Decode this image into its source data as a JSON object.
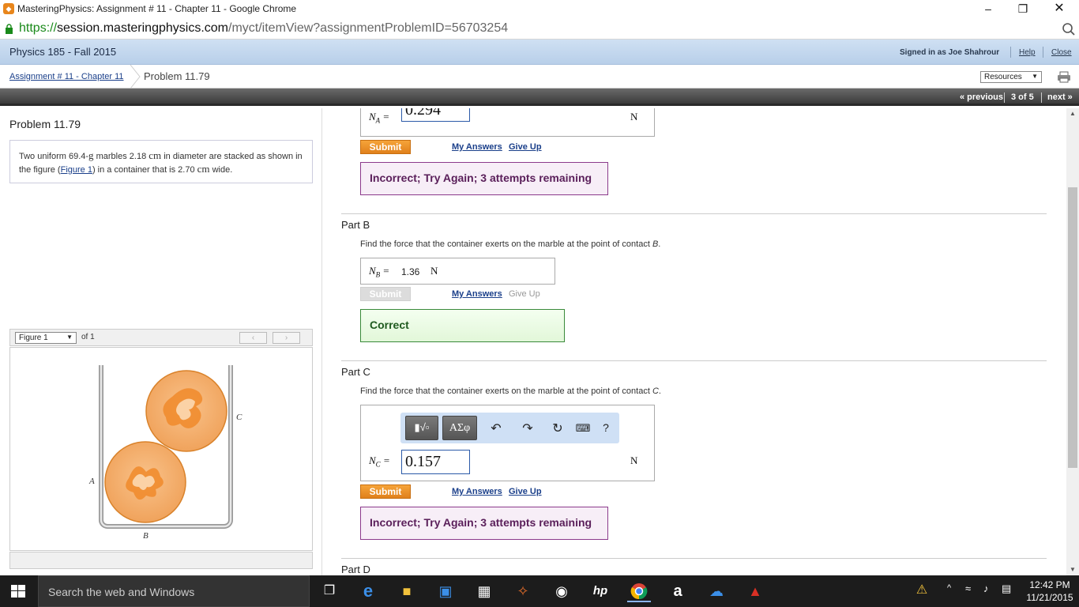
{
  "window": {
    "title": "MasteringPhysics: Assignment # 11 - Chapter 11 - Google Chrome"
  },
  "address": {
    "scheme": "https://",
    "host": "session.masteringphysics.com",
    "path": "/myct/itemView?assignmentProblemID=56703254"
  },
  "course": {
    "name": "Physics 185 - Fall 2015",
    "signed_in": "Signed in as Joe Shahrour",
    "help": "Help",
    "close": "Close"
  },
  "breadcrumb": {
    "assignment": "Assignment # 11 - Chapter 11",
    "problem": "Problem 11.79",
    "resources": "Resources"
  },
  "nav": {
    "previous": "« previous",
    "position": "3 of 5",
    "next": "next »"
  },
  "problem": {
    "title": "Problem 11.79",
    "desc_1": "Two uniform 69.4-",
    "desc_g": "g",
    "desc_2": " marbles 2.18 ",
    "desc_cm1": "cm",
    "desc_3": " in diameter are stacked as shown in the figure (",
    "desc_link": "Figure 1",
    "desc_4": ") in a container that is 2.70 ",
    "desc_cm2": "cm",
    "desc_5": " wide.",
    "figure_select": "Figure 1",
    "figure_of": "of 1",
    "figure_labels": {
      "a": "A",
      "b": "B",
      "c": "C"
    }
  },
  "partA": {
    "var": "N",
    "sub": "A",
    "eq": " =",
    "value": "0.294",
    "unit": "N",
    "submit": "Submit",
    "my_answers": "My Answers",
    "give_up": "Give Up",
    "feedback": "Incorrect; Try Again; 3 attempts remaining"
  },
  "partB": {
    "header": "Part B",
    "question_1": "Find the force that the container exerts on the marble at the point of contact ",
    "question_pt": "B",
    "question_2": ".",
    "var": "N",
    "sub": "B",
    "eq": " =",
    "value": "1.36",
    "unit": "N",
    "submit": "Submit",
    "my_answers": "My Answers",
    "give_up": "Give Up",
    "feedback": "Correct"
  },
  "partC": {
    "header": "Part C",
    "question_1": "Find the force that the container exerts on the marble at the point of contact ",
    "question_pt": "C",
    "question_2": ".",
    "toolbar_greek": "ΑΣφ",
    "toolbar_help": "?",
    "var": "N",
    "sub": "C",
    "eq": " =",
    "value": "0.157",
    "unit": "N",
    "submit": "Submit",
    "my_answers": "My Answers",
    "give_up": "Give Up",
    "feedback": "Incorrect; Try Again; 3 attempts remaining"
  },
  "partD": {
    "header": "Part D"
  },
  "taskbar": {
    "search": "Search the web and Windows",
    "time": "12:42 PM",
    "date": "11/21/2015"
  },
  "colors": {
    "accent_orange": "#e8861c",
    "course_bar": "#c4d7ee",
    "incorrect": "#8b3a8b",
    "correct": "#3a8a3a"
  }
}
